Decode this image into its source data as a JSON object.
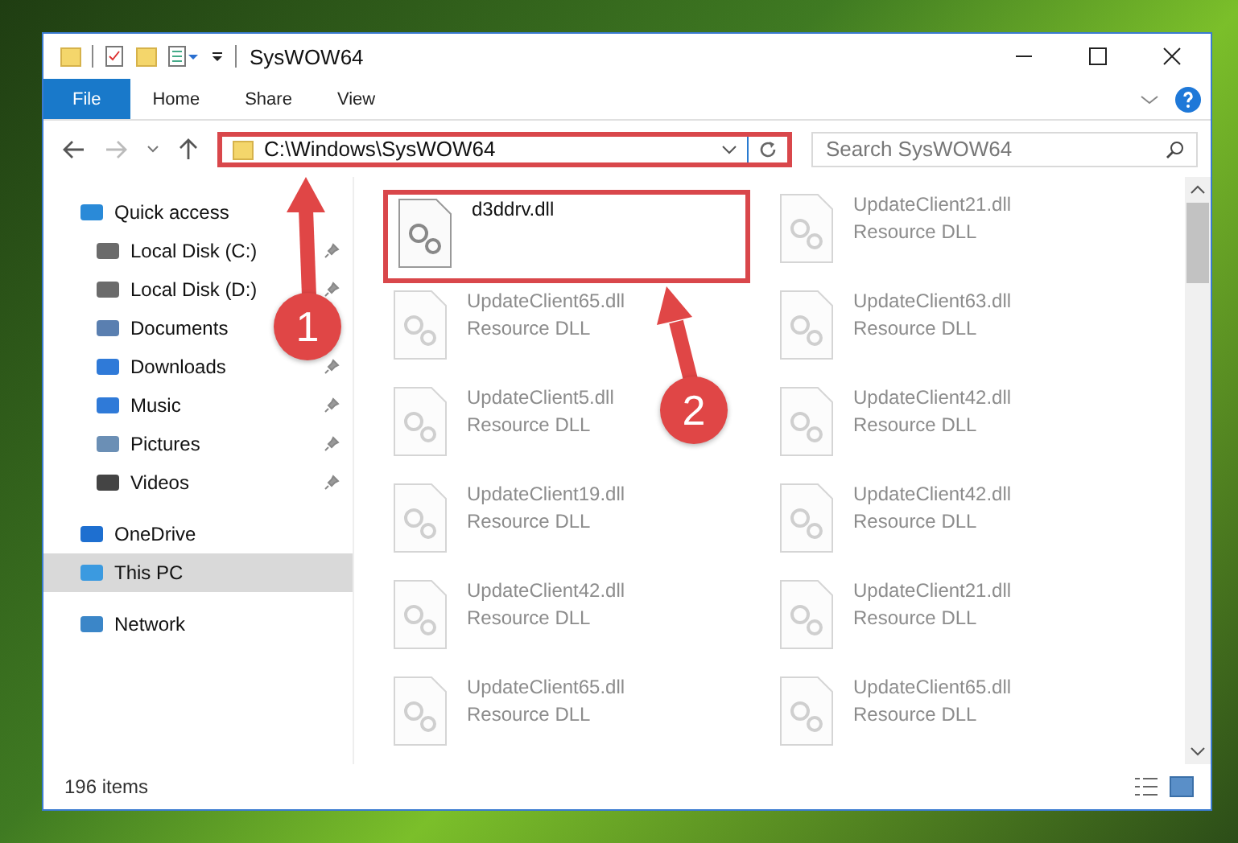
{
  "window": {
    "title": "SysWOW64"
  },
  "ribbon": {
    "tabs": [
      {
        "label": "File",
        "selected": true
      },
      {
        "label": "Home",
        "selected": false
      },
      {
        "label": "Share",
        "selected": false
      },
      {
        "label": "View",
        "selected": false
      }
    ]
  },
  "address_bar": {
    "path": "C:\\Windows\\SysWOW64",
    "highlighted": true
  },
  "search": {
    "placeholder": "Search SysWOW64"
  },
  "sidebar": {
    "items": [
      {
        "label": "Quick access",
        "selected": false,
        "children": [
          {
            "label": "Local Disk (C:)",
            "pinned": true,
            "selected": false
          },
          {
            "label": "Local Disk (D:)",
            "pinned": true,
            "selected": false
          },
          {
            "label": "Documents",
            "selected": false
          },
          {
            "label": "Downloads",
            "pinned": true,
            "selected": false
          },
          {
            "label": "Music",
            "pinned": true,
            "selected": false
          },
          {
            "label": "Pictures",
            "pinned": true,
            "selected": false
          },
          {
            "label": "Videos",
            "pinned": true,
            "selected": false
          }
        ]
      },
      {
        "label": "OneDrive",
        "selected": false
      },
      {
        "label": "This PC",
        "selected": true
      },
      {
        "label": "Network",
        "selected": false
      }
    ]
  },
  "files": [
    {
      "name": "d3ddrv.dll",
      "highlighted": true,
      "dimmed": false
    },
    {
      "name": "UpdateClient21.dll",
      "type": "Resource DLL",
      "highlighted": false,
      "dimmed": true
    },
    {
      "name": "UpdateClient65.dll",
      "type": "Resource DLL",
      "highlighted": false,
      "dimmed": true
    },
    {
      "name": "UpdateClient63.dll",
      "type": "Resource DLL",
      "highlighted": false,
      "dimmed": true
    },
    {
      "name": "UpdateClient5.dll",
      "type": "Resource DLL",
      "highlighted": false,
      "dimmed": true
    },
    {
      "name": "UpdateClient42.dll",
      "type": "Resource DLL",
      "highlighted": false,
      "dimmed": true
    },
    {
      "name": "UpdateClient19.dll",
      "type": "Resource DLL",
      "highlighted": false,
      "dimmed": true
    },
    {
      "name": "UpdateClient42.dll",
      "type": "Resource DLL",
      "highlighted": false,
      "dimmed": true
    },
    {
      "name": "UpdateClient42.dll",
      "type": "Resource DLL",
      "highlighted": false,
      "dimmed": true
    },
    {
      "name": "UpdateClient21.dll",
      "type": "Resource DLL",
      "highlighted": false,
      "dimmed": true
    },
    {
      "name": "UpdateClient65.dll",
      "type": "Resource DLL",
      "highlighted": false,
      "dimmed": true
    },
    {
      "name": "UpdateClient65.dll",
      "type": "Resource DLL",
      "highlighted": false,
      "dimmed": true
    }
  ],
  "callouts": [
    {
      "label": "1"
    },
    {
      "label": "2"
    }
  ],
  "status_bar": {
    "count": "196 items"
  }
}
